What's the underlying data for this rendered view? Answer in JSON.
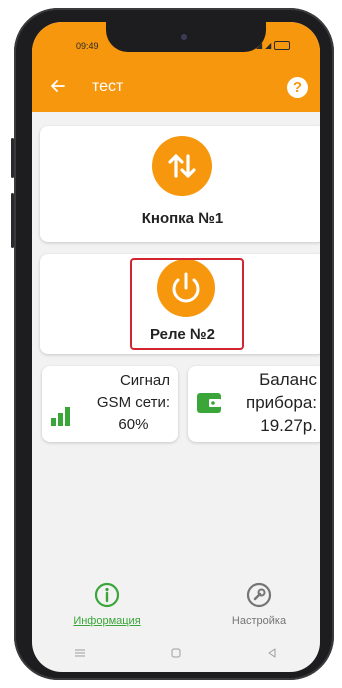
{
  "status_bar": {
    "time": "09:49"
  },
  "app_bar": {
    "title": "тест"
  },
  "cards": {
    "button1": {
      "label": "Кнопка №1"
    },
    "relay2": {
      "label": "Реле №2"
    }
  },
  "gsm": {
    "label_line1": "Сигнал",
    "label_line2": "GSM сети:",
    "value": "60%"
  },
  "balance": {
    "label_line1": "Баланс",
    "label_line2": "прибора:",
    "value": "19.27р."
  },
  "bottom_nav": {
    "info_label": "Информация",
    "settings_label": "Настройка"
  },
  "colors": {
    "accent": "#f7970e",
    "active_nav": "#3aa63a",
    "inactive_nav": "#757575",
    "highlight": "#d3242f"
  }
}
